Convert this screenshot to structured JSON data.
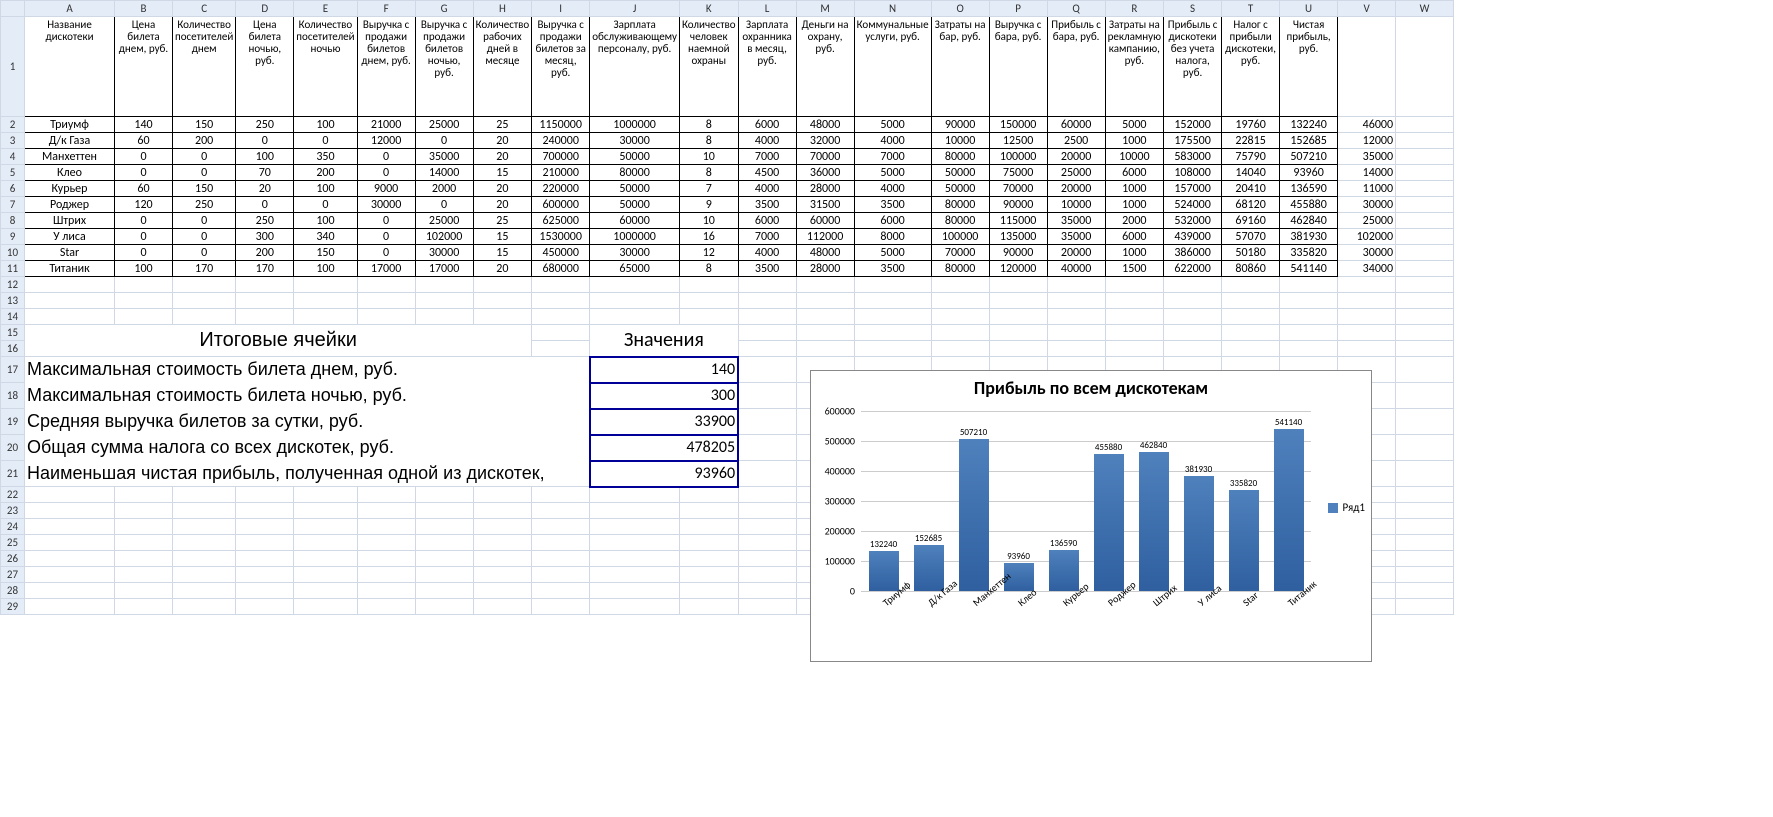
{
  "columns": [
    "",
    "A",
    "B",
    "C",
    "D",
    "E",
    "F",
    "G",
    "H",
    "I",
    "J",
    "K",
    "L",
    "M",
    "N",
    "O",
    "P",
    "Q",
    "R",
    "S",
    "T",
    "U",
    "V",
    "W"
  ],
  "headers": [
    "Название дискотеки",
    "Цена билета днем, руб.",
    "Количество посетителей днем",
    "Цена билета ночью, руб.",
    "Количество посетителей ночью",
    "Выручка с продажи билетов днем, руб.",
    "Выручка с продажи билетов ночью, руб.",
    "Количество рабочих дней в месяце",
    "Выручка с продажи билетов за месяц, руб.",
    "Зарплата обслуживающему персоналу, руб.",
    "Количество человек наемной охраны",
    "Зарплата охранника в месяц, руб.",
    "Деньги на охрану, руб.",
    "Коммунальные услуги, руб.",
    "Затраты на бар, руб.",
    "Выручка с бара, руб.",
    "Прибыль с бара, руб.",
    "Затраты на рекламную кампанию, руб.",
    "Прибыль с дискотеки без учета налога, руб.",
    "Налог с прибыли дискотеки, руб.",
    "Чистая прибыль, руб."
  ],
  "rows": [
    [
      "Триумф",
      140,
      150,
      250,
      100,
      21000,
      25000,
      25,
      1150000,
      1000000,
      8,
      6000,
      48000,
      5000,
      90000,
      150000,
      60000,
      5000,
      152000,
      19760,
      132240,
      46000
    ],
    [
      "Д/к Газа",
      60,
      200,
      0,
      0,
      12000,
      0,
      20,
      240000,
      30000,
      8,
      4000,
      32000,
      4000,
      10000,
      12500,
      2500,
      1000,
      175500,
      22815,
      152685,
      12000
    ],
    [
      "Манхеттен",
      0,
      0,
      100,
      350,
      0,
      35000,
      20,
      700000,
      50000,
      10,
      7000,
      70000,
      7000,
      80000,
      100000,
      20000,
      10000,
      583000,
      75790,
      507210,
      35000
    ],
    [
      "Клео",
      0,
      0,
      70,
      200,
      0,
      14000,
      15,
      210000,
      80000,
      8,
      4500,
      36000,
      5000,
      50000,
      75000,
      25000,
      6000,
      108000,
      14040,
      93960,
      14000
    ],
    [
      "Курьер",
      60,
      150,
      20,
      100,
      9000,
      2000,
      20,
      220000,
      50000,
      7,
      4000,
      28000,
      4000,
      50000,
      70000,
      20000,
      1000,
      157000,
      20410,
      136590,
      11000
    ],
    [
      "Роджер",
      120,
      250,
      0,
      0,
      30000,
      0,
      20,
      600000,
      50000,
      9,
      3500,
      31500,
      3500,
      80000,
      90000,
      10000,
      1000,
      524000,
      68120,
      455880,
      30000
    ],
    [
      "Штрих",
      0,
      0,
      250,
      100,
      0,
      25000,
      25,
      625000,
      60000,
      10,
      6000,
      60000,
      6000,
      80000,
      115000,
      35000,
      2000,
      532000,
      69160,
      462840,
      25000
    ],
    [
      "У лиса",
      0,
      0,
      300,
      340,
      0,
      102000,
      15,
      1530000,
      1000000,
      16,
      7000,
      112000,
      8000,
      100000,
      135000,
      35000,
      6000,
      439000,
      57070,
      381930,
      102000
    ],
    [
      "Star",
      0,
      0,
      200,
      150,
      0,
      30000,
      15,
      450000,
      30000,
      12,
      4000,
      48000,
      5000,
      70000,
      90000,
      20000,
      1000,
      386000,
      50180,
      335820,
      30000
    ],
    [
      "Титаник",
      100,
      170,
      170,
      100,
      17000,
      17000,
      20,
      680000,
      65000,
      8,
      3500,
      28000,
      3500,
      80000,
      120000,
      40000,
      1500,
      622000,
      80860,
      541140,
      34000
    ]
  ],
  "summary": {
    "title": "Итоговые ячейки",
    "val_title": "Значения",
    "items": [
      {
        "label": "Максимальная стоимость билета днем, руб.",
        "value": 140
      },
      {
        "label": "Максимальная стоимость билета ночью, руб.",
        "value": 300
      },
      {
        "label": "Средняя выручка билетов за сутки, руб.",
        "value": 33900
      },
      {
        "label": "Общая сумма налога со всех дискотек, руб.",
        "value": 478205
      },
      {
        "label": "Наименьшая чистая прибыль, полученная одной из дискотек,",
        "value": 93960
      }
    ]
  },
  "chart_data": {
    "type": "bar",
    "title": "Прибыль по всем дискотекам",
    "categories": [
      "Триумф",
      "Д/к Газа",
      "Манхеттен",
      "Клео",
      "Курьер",
      "Роджер",
      "Штрих",
      "У лиса",
      "Star",
      "Титаник"
    ],
    "values": [
      132240,
      152685,
      507210,
      93960,
      136590,
      455880,
      462840,
      381930,
      335820,
      541140
    ],
    "ylim": [
      0,
      600000
    ],
    "yticks": [
      0,
      100000,
      200000,
      300000,
      400000,
      500000,
      600000
    ],
    "legend": "Ряд1"
  }
}
